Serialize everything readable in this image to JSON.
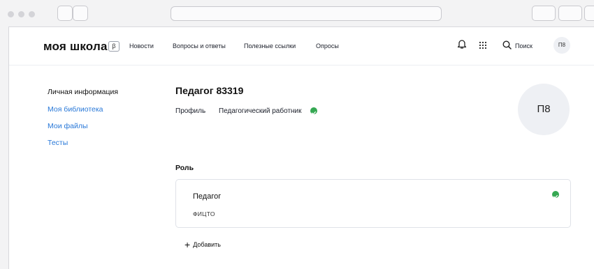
{
  "header": {
    "logo": "моя школа",
    "beta": "β",
    "nav": [
      "Новости",
      "Вопросы и ответы",
      "Полезные ссылки",
      "Опросы"
    ],
    "search_label": "Поиск",
    "avatar_initials": "П8",
    "icons": [
      "bell-icon",
      "apps-grid-icon",
      "search-icon"
    ]
  },
  "sidebar": {
    "items": [
      {
        "label": "Личная информация",
        "active": true
      },
      {
        "label": "Моя библиотека",
        "active": false
      },
      {
        "label": "Мои файлы",
        "active": false
      },
      {
        "label": "Тесты",
        "active": false
      }
    ]
  },
  "profile": {
    "name": "Педагог 83319",
    "profile_label": "Профиль",
    "profile_value": "Педагогический работник",
    "avatar_initials": "П8"
  },
  "roles": {
    "heading": "Роль",
    "items": [
      {
        "title": "Педагог",
        "subtitle": "ФИЦТО"
      }
    ],
    "add_label": "Добавить"
  },
  "colors": {
    "link": "#2878d8",
    "check": "#35a852",
    "avatar_bg": "#eef0f4"
  }
}
